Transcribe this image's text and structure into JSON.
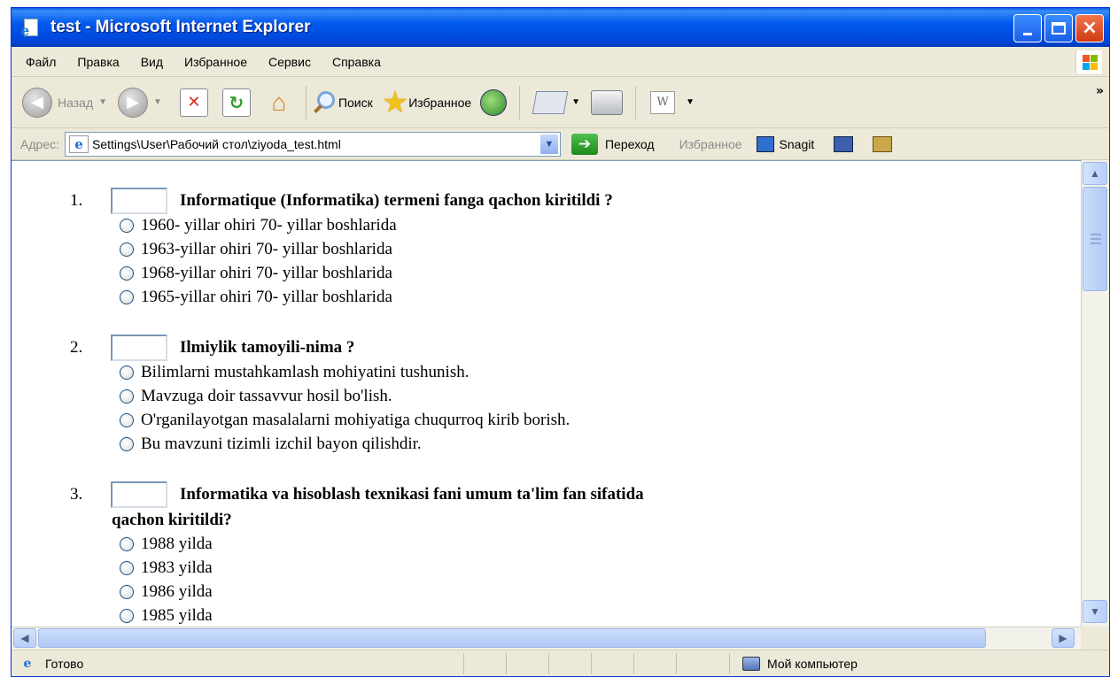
{
  "window": {
    "title": "test - Microsoft Internet Explorer"
  },
  "menu": {
    "items": [
      "Файл",
      "Правка",
      "Вид",
      "Избранное",
      "Сервис",
      "Справка"
    ]
  },
  "toolbar": {
    "back_label": "Назад",
    "search_label": "Поиск",
    "favorites_label": "Избранное",
    "word_label": "W",
    "more": "»"
  },
  "address": {
    "label": "Адрес:",
    "value": "Settings\\User\\Рабочий стол\\ziyoda_test.html",
    "go_label": "Переход",
    "favorites_label": "Избранное",
    "snagit_label": "Snagit"
  },
  "questions": [
    {
      "number": "1.",
      "text": "Informatique (Informatika) termeni fanga qachon kiritildi ?",
      "text_cont": "",
      "options": [
        "1960- yillar ohiri 70- yillar boshlarida",
        "1963-yillar ohiri 70- yillar boshlarida",
        "1968-yillar ohiri 70- yillar boshlarida",
        "1965-yillar ohiri 70- yillar boshlarida"
      ]
    },
    {
      "number": "2.",
      "text": "Ilmiylik tamoyili-nima ?",
      "text_cont": "",
      "options": [
        "Bilimlarni mustahkamlash mohiyatini tushunish.",
        "Mavzuga doir tassavvur hosil bo'lish.",
        "O'rganilayotgan masalalarni mohiyatiga chuqurroq kirib borish.",
        "Bu mavzuni tizimli izchil bayon qilishdir."
      ]
    },
    {
      "number": "3.",
      "text": "Informatika va hisoblash texnikasi fani umum ta'lim fan sifatida",
      "text_cont": "qachon kiritildi?",
      "options": [
        "1988 yilda",
        "1983 yilda",
        "1986 yilda",
        "1985 yilda"
      ]
    }
  ],
  "status": {
    "text": "Готово",
    "zone": "Мой компьютер"
  }
}
